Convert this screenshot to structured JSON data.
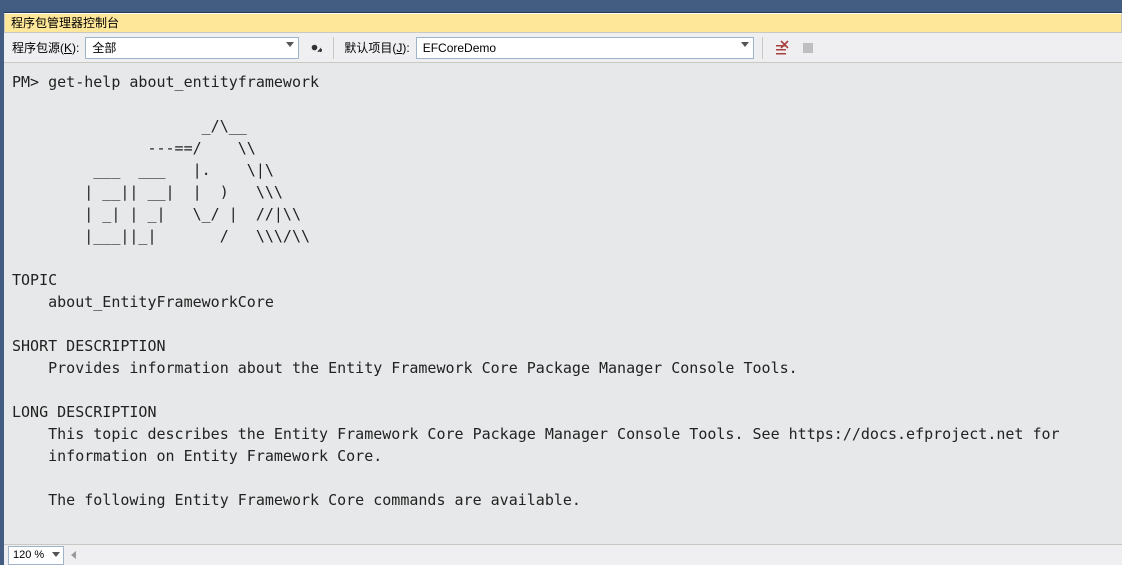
{
  "title": "程序包管理器控制台",
  "toolbar": {
    "source_label_pre": "程序包源(",
    "source_label_key": "K",
    "source_label_post": "):",
    "source_value": "全部",
    "project_label_pre": "默认项目(",
    "project_label_key": "J",
    "project_label_post": "):",
    "project_value": "EFCoreDemo"
  },
  "console": {
    "prompt": "PM>",
    "command": "get-help about_entityframework",
    "body": "\n                     _/\\__\n               ---==/    \\\\\n         ___  ___   |.    \\|\\\n        | __|| __|  |  )   \\\\\\\n        | _| | _|   \\_/ |  //|\\\\\n        |___||_|       /   \\\\\\/\\\\\n\nTOPIC\n    about_EntityFrameworkCore\n\nSHORT DESCRIPTION\n    Provides information about the Entity Framework Core Package Manager Console Tools.\n\nLONG DESCRIPTION\n    This topic describes the Entity Framework Core Package Manager Console Tools. See https://docs.efproject.net for\n    information on Entity Framework Core.\n\n    The following Entity Framework Core commands are available."
  },
  "status": {
    "zoom": "120 %"
  }
}
